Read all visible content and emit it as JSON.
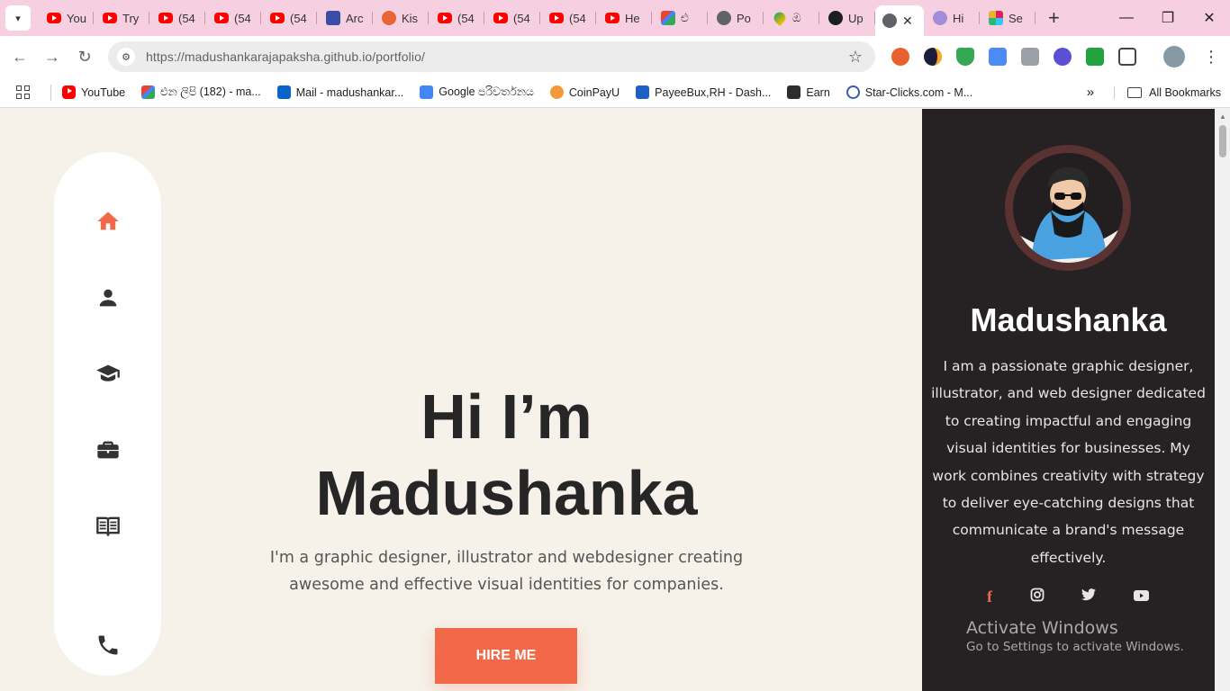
{
  "browser": {
    "tabs": [
      {
        "icon": "youtube-icon",
        "title": "You"
      },
      {
        "icon": "youtube-icon",
        "title": "Try"
      },
      {
        "icon": "youtube-icon",
        "title": "(54"
      },
      {
        "icon": "youtube-icon",
        "title": "(54"
      },
      {
        "icon": "youtube-icon",
        "title": "(54"
      },
      {
        "icon": "archive-icon",
        "title": "Arc"
      },
      {
        "icon": "kiwi-icon",
        "title": "Kis"
      },
      {
        "icon": "youtube-icon",
        "title": "(54"
      },
      {
        "icon": "youtube-icon",
        "title": "(54"
      },
      {
        "icon": "youtube-icon",
        "title": "(54"
      },
      {
        "icon": "youtube-icon",
        "title": "He"
      },
      {
        "icon": "gmail-icon",
        "title": "එ"
      },
      {
        "icon": "globe-icon",
        "title": "Po"
      },
      {
        "icon": "maps-icon",
        "title": "ඔ"
      },
      {
        "icon": "github-icon",
        "title": "Up"
      },
      {
        "icon": "globe-icon",
        "title": ""
      },
      {
        "icon": "generic-icon",
        "title": "Hi"
      },
      {
        "icon": "slack-icon",
        "title": "Se"
      }
    ],
    "url_host": "https://madushankarajapaksha.github.io",
    "url_path": "/portfolio/",
    "bookmarks": [
      {
        "icon": "youtube-icon",
        "label": "YouTube"
      },
      {
        "icon": "gmail-icon",
        "label": "එන ලිපි (182) - ma..."
      },
      {
        "icon": "outlook-icon",
        "label": "Mail - madushankar..."
      },
      {
        "icon": "translate-icon",
        "label": "Google පරිවර්තනය"
      },
      {
        "icon": "coinpayu-icon",
        "label": "CoinPayU"
      },
      {
        "icon": "payeebux-icon",
        "label": "PayeeBux,RH - Dash..."
      },
      {
        "icon": "earn-icon",
        "label": "Earn"
      },
      {
        "icon": "starclicks-icon",
        "label": "Star-Clicks.com - M..."
      }
    ],
    "all_bookmarks": "All Bookmarks"
  },
  "hero": {
    "line1": "Hi I’m",
    "line2": "Madushanka",
    "subtitle": "I'm a graphic designer, illustrator and webdesigner creating awesome and effective visual identities for companies.",
    "cta": "HIRE ME"
  },
  "profile": {
    "name": "Madushanka",
    "bio": "I am a passionate graphic designer, illustrator, and web designer dedicated to creating impactful and engaging visual identities for businesses. My work combines creativity with strategy to deliver eye-catching designs that communicate a brand's message effectively.",
    "socials": [
      "facebook-icon",
      "instagram-icon",
      "twitter-icon",
      "youtube-icon"
    ]
  },
  "watermark": {
    "title": "Activate Windows",
    "subtitle": "Go to Settings to activate Windows."
  },
  "colors": {
    "accent": "#f2694a",
    "page_bg": "#f6f2ea",
    "sidebar_bg": "#262223",
    "tabstrip_bg": "#f6cfe0"
  }
}
